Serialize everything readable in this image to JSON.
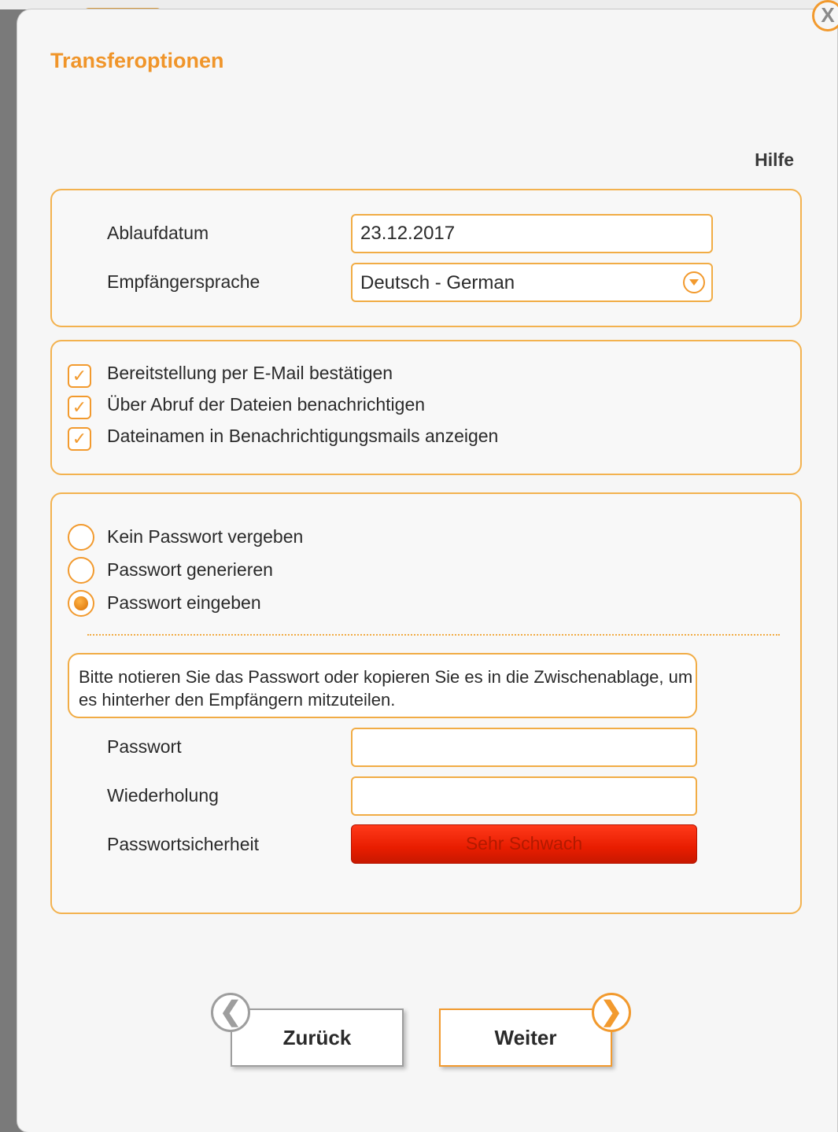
{
  "dialog": {
    "title": "Transferoptionen",
    "help_label": "Hilfe",
    "close_label": "X",
    "accent_color": "#f29a2e"
  },
  "general": {
    "expiry_label": "Ablaufdatum",
    "expiry_value": "23.12.2017",
    "language_label": "Empfängersprache",
    "language_value": "Deutsch - German"
  },
  "notifications": {
    "items": [
      {
        "label": "Bereitstellung per E-Mail bestätigen",
        "checked": true
      },
      {
        "label": "Über Abruf der Dateien benachrichtigen",
        "checked": true
      },
      {
        "label": "Dateinamen in Benachrichtigungsmails anzeigen",
        "checked": true
      }
    ]
  },
  "password": {
    "options": [
      {
        "label": "Kein Passwort vergeben",
        "selected": false
      },
      {
        "label": "Passwort generieren",
        "selected": false
      },
      {
        "label": "Passwort eingeben",
        "selected": true
      }
    ],
    "notice": "Bitte notieren Sie das Passwort oder kopieren Sie es in die Zwischenablage, um es hinterher den Empfängern mitzuteilen.",
    "password_label": "Passwort",
    "password_value": "",
    "repeat_label": "Wiederholung",
    "repeat_value": "",
    "strength_label": "Passwortsicherheit",
    "strength_value": "Sehr Schwach",
    "strength_color": "#e81d00"
  },
  "navigation": {
    "back_label": "Zurück",
    "next_label": "Weiter"
  }
}
